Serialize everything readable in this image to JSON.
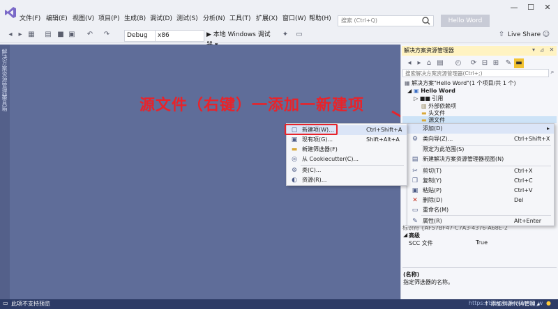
{
  "menubar": {
    "items": [
      "文件(F)",
      "编辑(E)",
      "视图(V)",
      "项目(P)",
      "生成(B)",
      "调试(D)",
      "测试(S)",
      "分析(N)",
      "工具(T)",
      "扩展(X)",
      "窗口(W)",
      "帮助(H)"
    ],
    "search_placeholder": "搜索 (Ctrl+Q)",
    "project_name": "Hello Word",
    "window_controls": [
      "—",
      "☐",
      "✕"
    ]
  },
  "toolbar": {
    "config": "Debug",
    "platform": "x86",
    "run_label": "▶ 本地 Windows 调试器 ▾",
    "live_share": "Live Share"
  },
  "left_tabs": [
    "解决方案资源管理器",
    "工具箱"
  ],
  "annotation": "源文件（右键）一添加一新建项",
  "solution_explorer": {
    "title": "解决方案资源管理器",
    "search_placeholder": "搜索解决方案资源管理器(Ctrl+;)",
    "tree": [
      {
        "label": "解决方案\"Hello Word\"(1 个项目/共 1 个)"
      },
      {
        "label": "Hello Word"
      },
      {
        "label": "■■ 引用"
      },
      {
        "label": "外部依赖项"
      },
      {
        "label": "头文件"
      },
      {
        "label": "源文件"
      }
    ],
    "props_partial": "标识符       {AF57BF47-C7A3-4376-A68E-2",
    "props_header": "高级",
    "props_scc_label": "SCC 文件",
    "props_scc_value": "True",
    "props_name": "(名称)",
    "props_desc": "指定筛选器的名称。"
  },
  "context_menu_main": {
    "items": [
      {
        "label": "添加(D)",
        "shortcut": "▸",
        "icon": "blank"
      },
      {
        "label": "类向导(Z)...",
        "shortcut": "Ctrl+Shift+X",
        "icon": "class-wizard-icon"
      },
      {
        "label": "限定为此范围(S)",
        "shortcut": "",
        "icon": "blank"
      },
      {
        "label": "新建解决方案资源管理器视图(N)",
        "shortcut": "",
        "icon": "new-view-icon"
      },
      {
        "label": "剪切(T)",
        "shortcut": "Ctrl+X",
        "icon": "cut-icon"
      },
      {
        "label": "复制(Y)",
        "shortcut": "Ctrl+C",
        "icon": "copy-icon"
      },
      {
        "label": "粘贴(P)",
        "shortcut": "Ctrl+V",
        "icon": "paste-icon"
      },
      {
        "label": "删除(D)",
        "shortcut": "Del",
        "icon": "delete-icon"
      },
      {
        "label": "重命名(M)",
        "shortcut": "",
        "icon": "rename-icon"
      },
      {
        "label": "属性(R)",
        "shortcut": "Alt+Enter",
        "icon": "wrench-icon"
      }
    ]
  },
  "context_menu_add": {
    "items": [
      {
        "label": "新建项(W)...",
        "shortcut": "Ctrl+Shift+A",
        "icon": "new-item-icon"
      },
      {
        "label": "现有项(G)...",
        "shortcut": "Shift+Alt+A",
        "icon": "existing-item-icon"
      },
      {
        "label": "新建筛选器(F)",
        "shortcut": "",
        "icon": "folder-icon"
      },
      {
        "label": "从 Cookiecutter(C)...",
        "shortcut": "",
        "icon": "cookie-icon"
      },
      {
        "label": "类(C)...",
        "shortcut": "",
        "icon": "class-icon"
      },
      {
        "label": "资源(R)...",
        "shortcut": "",
        "icon": "resource-icon"
      }
    ]
  },
  "status_bar": {
    "left": "此项不支持预览",
    "right": "↑ 添加到源代码管理 ▴",
    "watermark": "https://blog.csdn.net/qq_w"
  },
  "colors": {
    "accent": "#2d3b66",
    "canvas": "#5f6d99",
    "annotation": "#e8232a",
    "highlight": "#dbe5f7"
  }
}
